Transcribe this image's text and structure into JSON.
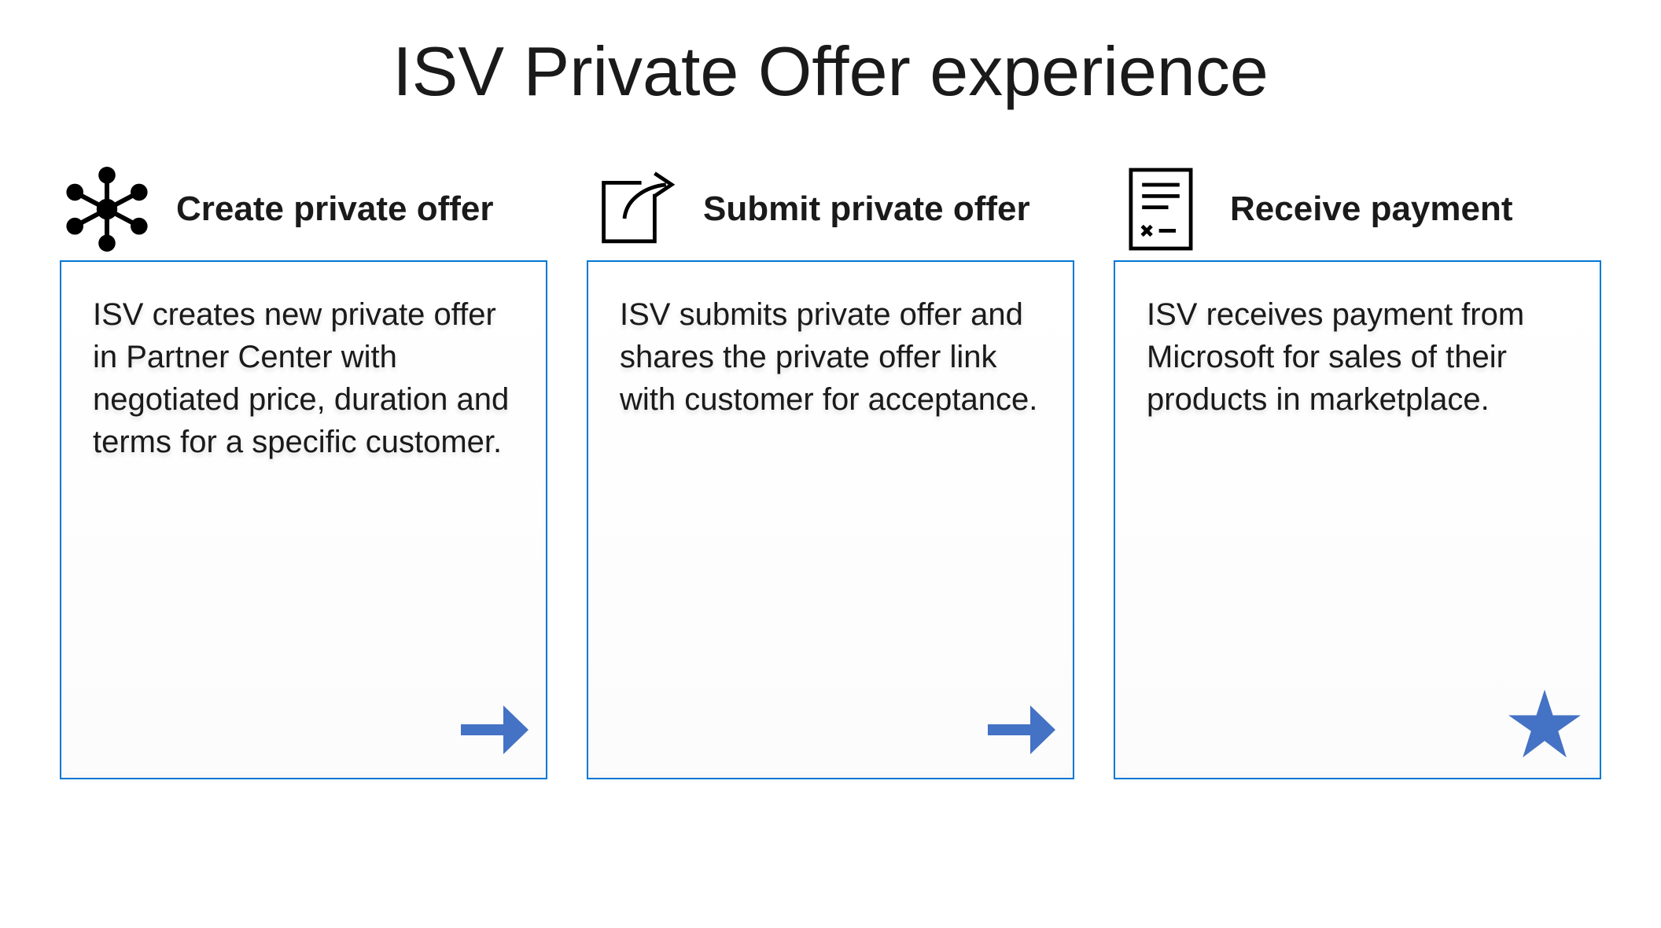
{
  "title": "ISV Private Offer experience",
  "steps": [
    {
      "icon": "network-hub-icon",
      "heading": "Create private offer",
      "body": "ISV creates new private offer in Partner Center with negotiated price, duration and terms for a specific customer.",
      "corner": "arrow"
    },
    {
      "icon": "share-icon",
      "heading": "Submit private offer",
      "body": "ISV submits private offer and shares the private offer link with customer for acceptance.",
      "corner": "arrow"
    },
    {
      "icon": "document-icon",
      "heading": "Receive payment",
      "body": "ISV receives payment from Microsoft for sales of their products in marketplace.",
      "corner": "star"
    }
  ],
  "colors": {
    "border": "#0078D4",
    "arrow": "#4472C4",
    "star": "#4472C4"
  }
}
